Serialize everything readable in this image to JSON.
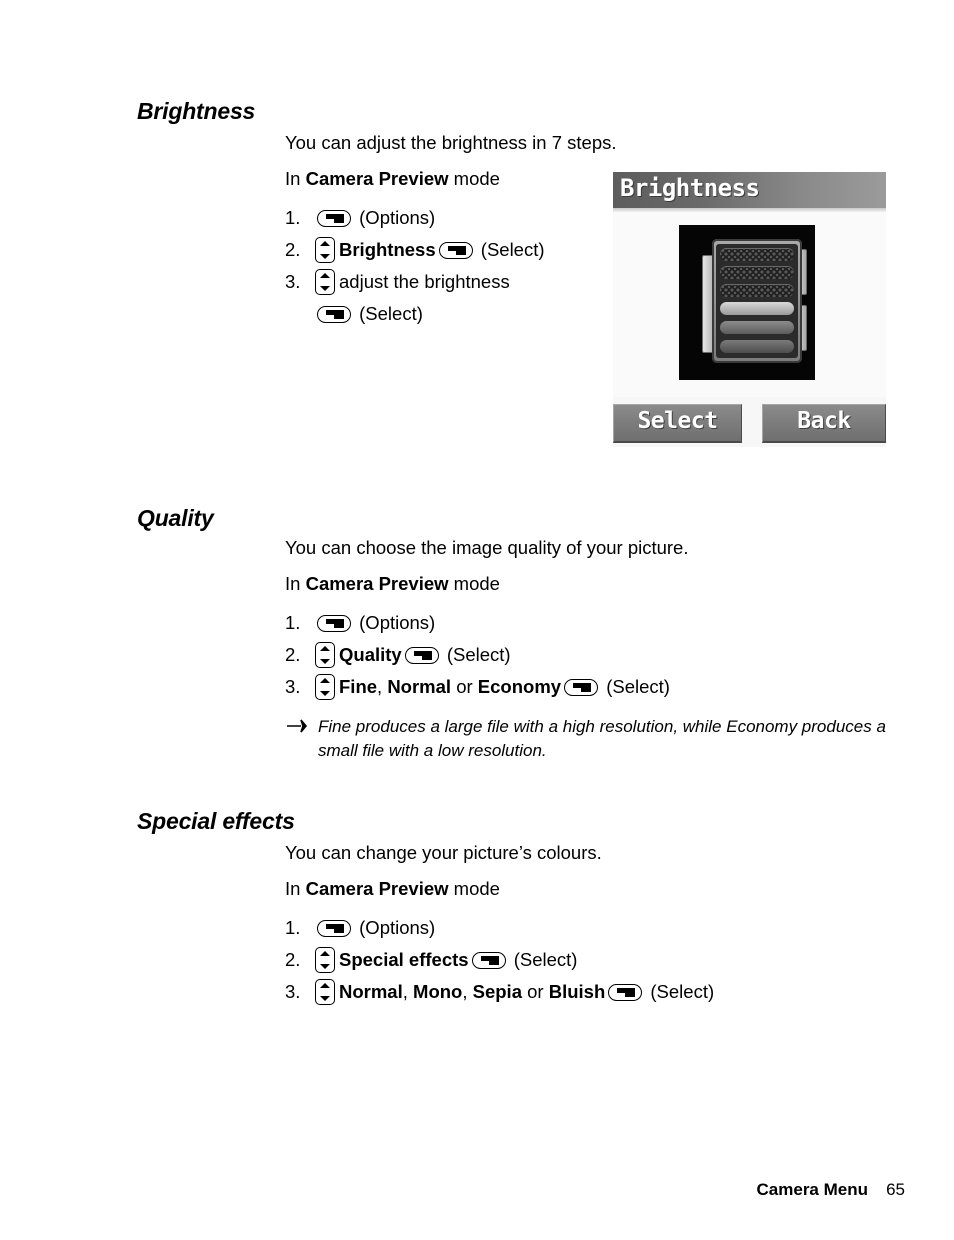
{
  "page": {
    "footer_title": "Camera Menu",
    "page_number": "65"
  },
  "sections": [
    {
      "heading": "Brightness",
      "intro": "You can adjust the brightness in 7 steps.",
      "mode_prefix": "In ",
      "mode_bold": "Camera Preview",
      "mode_suffix": " mode",
      "steps": [
        {
          "num": "1.",
          "softkey_before": true,
          "label": "(Options)"
        },
        {
          "num": "2.",
          "nav": true,
          "bold_label": "Brightness",
          "softkey_after": true,
          "label": "(Select)"
        },
        {
          "num": "3.",
          "nav": true,
          "plain_label": "adjust the brightness",
          "sub_softkey": true,
          "sub_label": "(Select)"
        }
      ]
    },
    {
      "heading": "Quality",
      "intro": "You can choose the image quality of your picture.",
      "mode_prefix": "In ",
      "mode_bold": "Camera Preview",
      "mode_suffix": " mode",
      "steps": [
        {
          "num": "1.",
          "label": "(Options)"
        },
        {
          "num": "2.",
          "bold_label": "Quality",
          "label": "(Select)"
        },
        {
          "num": "3.",
          "label": "(Select)"
        }
      ],
      "quality_options": [
        "Fine",
        "Normal",
        "Economy"
      ],
      "quality_separator": " or ",
      "quality_comma": ", ",
      "note": "Fine produces a large file with a high resolution, while Economy produces a small file with a low resolution."
    },
    {
      "heading": "Special effects",
      "intro": "You can change your picture’s colours.",
      "mode_prefix": "In ",
      "mode_bold": "Camera Preview",
      "mode_suffix": " mode",
      "steps": [
        {
          "num": "1.",
          "label": "(Options)"
        },
        {
          "num": "2.",
          "bold_label": "Special effects",
          "label": "(Select)"
        },
        {
          "num": "3.",
          "label": "(Select)"
        }
      ],
      "effect_options": [
        "Normal",
        "Mono",
        "Sepia",
        "Bluish"
      ],
      "effect_separator": " or ",
      "effect_comma": ", "
    }
  ],
  "phone_screen": {
    "title": "Brightness",
    "softkey_left": "Select",
    "softkey_right": "Back",
    "title_bar_color": "#6e6e6e",
    "softkey_color": "#7e7e7e",
    "screen_background": "#fafafa",
    "photo_background": "#050505"
  },
  "icons": {
    "softkey": "softkey-icon",
    "nav_updown": "nav-up-down-icon",
    "note_bullet": "arrow-bullet-icon"
  }
}
